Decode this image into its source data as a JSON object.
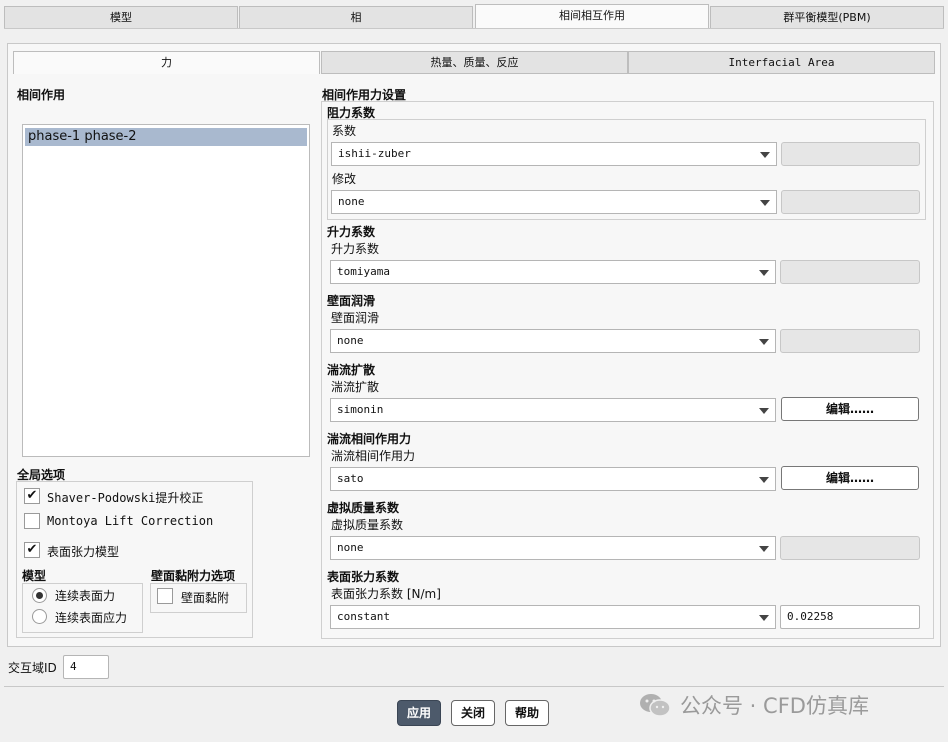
{
  "top_tabs": [
    {
      "label": "模型"
    },
    {
      "label": "相"
    },
    {
      "label": "相间相互作用"
    },
    {
      "label": "群平衡模型(PBM)"
    }
  ],
  "sub_tabs": [
    {
      "label": "力"
    },
    {
      "label": "热量、质量、反应"
    },
    {
      "label": "Interfacial Area"
    }
  ],
  "interaction": {
    "title": "相间作用",
    "items": [
      "phase-1 phase-2"
    ]
  },
  "global_options": {
    "title": "全局选项",
    "shaver_label": "Shaver-Podowski提升校正",
    "shaver_checked": true,
    "montoya_label": "Montoya Lift Correction",
    "montoya_checked": false,
    "surface_tension_label": "表面张力模型",
    "surface_tension_checked": true,
    "model_title": "模型",
    "model_options": [
      "连续表面力",
      "连续表面应力"
    ],
    "wall_adhesion_title": "壁面黏附力选项",
    "wall_adhesion_label": "壁面黏附"
  },
  "force_settings": {
    "title": "相间作用力设置",
    "drag": {
      "title": "阻力系数",
      "coef_label": "系数",
      "coef_value": "ishii-zuber",
      "modify_label": "修改",
      "modify_value": "none"
    },
    "lift": {
      "title": "升力系数",
      "label": "升力系数",
      "value": "tomiyama"
    },
    "wall_lubrication": {
      "title": "壁面润滑",
      "label": "壁面润滑",
      "value": "none"
    },
    "turb_dispersion": {
      "title": "湍流扩散",
      "label": "湍流扩散",
      "value": "simonin",
      "edit_label": "编辑……"
    },
    "turb_interaction": {
      "title": "湍流相间作用力",
      "label": "湍流相间作用力",
      "value": "sato",
      "edit_label": "编辑……"
    },
    "virtual_mass": {
      "title": "虚拟质量系数",
      "label": "虚拟质量系数",
      "value": "none"
    },
    "surface_tension": {
      "title": "表面张力系数",
      "label": "表面张力系数 [N/m]",
      "value": "constant",
      "number": "0.02258"
    }
  },
  "domain_id": {
    "label": "交互域ID",
    "value": "4"
  },
  "buttons": {
    "apply": "应用",
    "close": "关闭",
    "help": "帮助"
  },
  "watermark": "公众号 · CFD仿真库"
}
